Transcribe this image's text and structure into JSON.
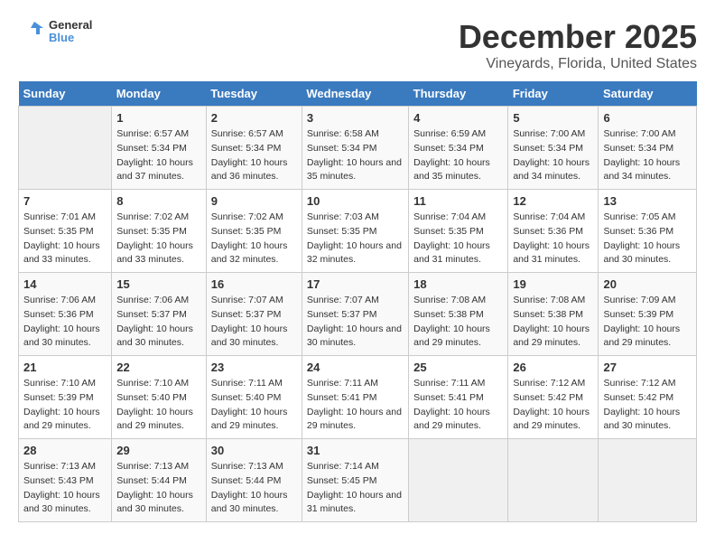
{
  "logo": {
    "general": "General",
    "blue": "Blue"
  },
  "title": "December 2025",
  "subtitle": "Vineyards, Florida, United States",
  "days_header": [
    "Sunday",
    "Monday",
    "Tuesday",
    "Wednesday",
    "Thursday",
    "Friday",
    "Saturday"
  ],
  "weeks": [
    [
      {
        "num": "",
        "sunrise": "",
        "sunset": "",
        "daylight": ""
      },
      {
        "num": "1",
        "sunrise": "Sunrise: 6:57 AM",
        "sunset": "Sunset: 5:34 PM",
        "daylight": "Daylight: 10 hours and 37 minutes."
      },
      {
        "num": "2",
        "sunrise": "Sunrise: 6:57 AM",
        "sunset": "Sunset: 5:34 PM",
        "daylight": "Daylight: 10 hours and 36 minutes."
      },
      {
        "num": "3",
        "sunrise": "Sunrise: 6:58 AM",
        "sunset": "Sunset: 5:34 PM",
        "daylight": "Daylight: 10 hours and 35 minutes."
      },
      {
        "num": "4",
        "sunrise": "Sunrise: 6:59 AM",
        "sunset": "Sunset: 5:34 PM",
        "daylight": "Daylight: 10 hours and 35 minutes."
      },
      {
        "num": "5",
        "sunrise": "Sunrise: 7:00 AM",
        "sunset": "Sunset: 5:34 PM",
        "daylight": "Daylight: 10 hours and 34 minutes."
      },
      {
        "num": "6",
        "sunrise": "Sunrise: 7:00 AM",
        "sunset": "Sunset: 5:34 PM",
        "daylight": "Daylight: 10 hours and 34 minutes."
      }
    ],
    [
      {
        "num": "7",
        "sunrise": "Sunrise: 7:01 AM",
        "sunset": "Sunset: 5:35 PM",
        "daylight": "Daylight: 10 hours and 33 minutes."
      },
      {
        "num": "8",
        "sunrise": "Sunrise: 7:02 AM",
        "sunset": "Sunset: 5:35 PM",
        "daylight": "Daylight: 10 hours and 33 minutes."
      },
      {
        "num": "9",
        "sunrise": "Sunrise: 7:02 AM",
        "sunset": "Sunset: 5:35 PM",
        "daylight": "Daylight: 10 hours and 32 minutes."
      },
      {
        "num": "10",
        "sunrise": "Sunrise: 7:03 AM",
        "sunset": "Sunset: 5:35 PM",
        "daylight": "Daylight: 10 hours and 32 minutes."
      },
      {
        "num": "11",
        "sunrise": "Sunrise: 7:04 AM",
        "sunset": "Sunset: 5:35 PM",
        "daylight": "Daylight: 10 hours and 31 minutes."
      },
      {
        "num": "12",
        "sunrise": "Sunrise: 7:04 AM",
        "sunset": "Sunset: 5:36 PM",
        "daylight": "Daylight: 10 hours and 31 minutes."
      },
      {
        "num": "13",
        "sunrise": "Sunrise: 7:05 AM",
        "sunset": "Sunset: 5:36 PM",
        "daylight": "Daylight: 10 hours and 30 minutes."
      }
    ],
    [
      {
        "num": "14",
        "sunrise": "Sunrise: 7:06 AM",
        "sunset": "Sunset: 5:36 PM",
        "daylight": "Daylight: 10 hours and 30 minutes."
      },
      {
        "num": "15",
        "sunrise": "Sunrise: 7:06 AM",
        "sunset": "Sunset: 5:37 PM",
        "daylight": "Daylight: 10 hours and 30 minutes."
      },
      {
        "num": "16",
        "sunrise": "Sunrise: 7:07 AM",
        "sunset": "Sunset: 5:37 PM",
        "daylight": "Daylight: 10 hours and 30 minutes."
      },
      {
        "num": "17",
        "sunrise": "Sunrise: 7:07 AM",
        "sunset": "Sunset: 5:37 PM",
        "daylight": "Daylight: 10 hours and 30 minutes."
      },
      {
        "num": "18",
        "sunrise": "Sunrise: 7:08 AM",
        "sunset": "Sunset: 5:38 PM",
        "daylight": "Daylight: 10 hours and 29 minutes."
      },
      {
        "num": "19",
        "sunrise": "Sunrise: 7:08 AM",
        "sunset": "Sunset: 5:38 PM",
        "daylight": "Daylight: 10 hours and 29 minutes."
      },
      {
        "num": "20",
        "sunrise": "Sunrise: 7:09 AM",
        "sunset": "Sunset: 5:39 PM",
        "daylight": "Daylight: 10 hours and 29 minutes."
      }
    ],
    [
      {
        "num": "21",
        "sunrise": "Sunrise: 7:10 AM",
        "sunset": "Sunset: 5:39 PM",
        "daylight": "Daylight: 10 hours and 29 minutes."
      },
      {
        "num": "22",
        "sunrise": "Sunrise: 7:10 AM",
        "sunset": "Sunset: 5:40 PM",
        "daylight": "Daylight: 10 hours and 29 minutes."
      },
      {
        "num": "23",
        "sunrise": "Sunrise: 7:11 AM",
        "sunset": "Sunset: 5:40 PM",
        "daylight": "Daylight: 10 hours and 29 minutes."
      },
      {
        "num": "24",
        "sunrise": "Sunrise: 7:11 AM",
        "sunset": "Sunset: 5:41 PM",
        "daylight": "Daylight: 10 hours and 29 minutes."
      },
      {
        "num": "25",
        "sunrise": "Sunrise: 7:11 AM",
        "sunset": "Sunset: 5:41 PM",
        "daylight": "Daylight: 10 hours and 29 minutes."
      },
      {
        "num": "26",
        "sunrise": "Sunrise: 7:12 AM",
        "sunset": "Sunset: 5:42 PM",
        "daylight": "Daylight: 10 hours and 29 minutes."
      },
      {
        "num": "27",
        "sunrise": "Sunrise: 7:12 AM",
        "sunset": "Sunset: 5:42 PM",
        "daylight": "Daylight: 10 hours and 30 minutes."
      }
    ],
    [
      {
        "num": "28",
        "sunrise": "Sunrise: 7:13 AM",
        "sunset": "Sunset: 5:43 PM",
        "daylight": "Daylight: 10 hours and 30 minutes."
      },
      {
        "num": "29",
        "sunrise": "Sunrise: 7:13 AM",
        "sunset": "Sunset: 5:44 PM",
        "daylight": "Daylight: 10 hours and 30 minutes."
      },
      {
        "num": "30",
        "sunrise": "Sunrise: 7:13 AM",
        "sunset": "Sunset: 5:44 PM",
        "daylight": "Daylight: 10 hours and 30 minutes."
      },
      {
        "num": "31",
        "sunrise": "Sunrise: 7:14 AM",
        "sunset": "Sunset: 5:45 PM",
        "daylight": "Daylight: 10 hours and 31 minutes."
      },
      {
        "num": "",
        "sunrise": "",
        "sunset": "",
        "daylight": ""
      },
      {
        "num": "",
        "sunrise": "",
        "sunset": "",
        "daylight": ""
      },
      {
        "num": "",
        "sunrise": "",
        "sunset": "",
        "daylight": ""
      }
    ]
  ]
}
